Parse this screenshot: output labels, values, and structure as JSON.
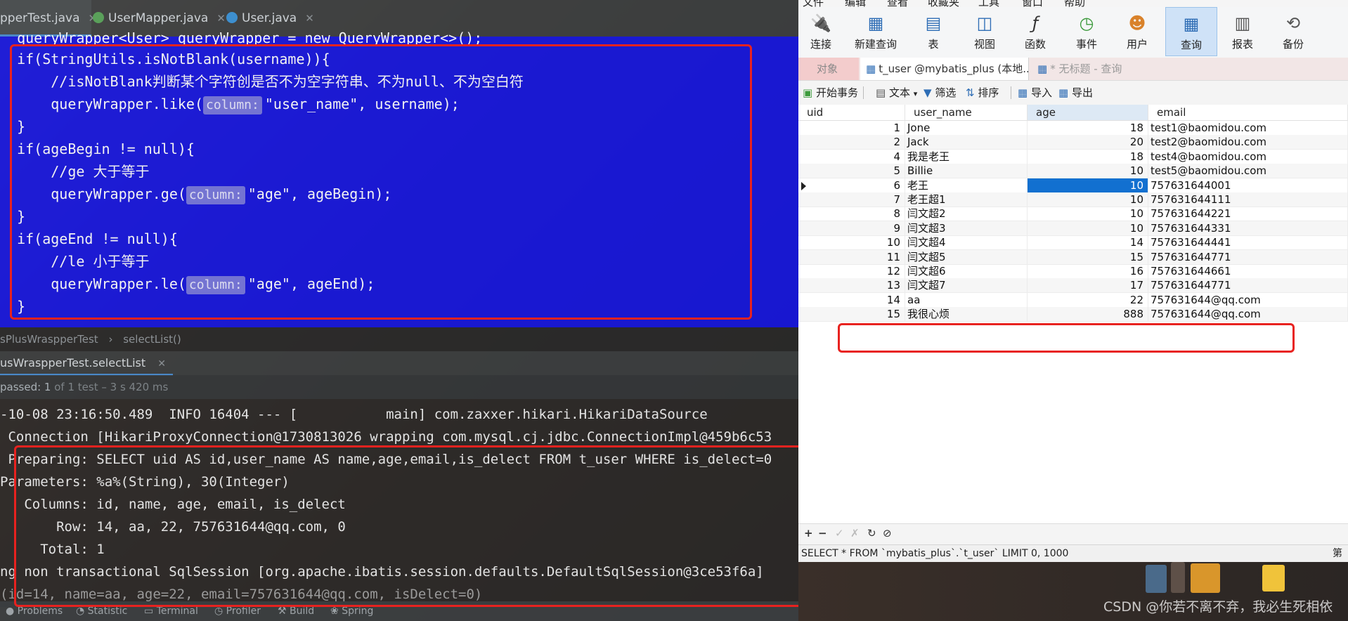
{
  "ide": {
    "tabs": [
      {
        "label": "pperTest.java",
        "icon": "java-class-icon",
        "color": "#5aa05a"
      },
      {
        "label": "UserMapper.java",
        "icon": "java-interface-icon",
        "color": "#5aa05a"
      },
      {
        "label": "User.java",
        "icon": "java-class-icon",
        "color": "#3d8fcf"
      }
    ],
    "code_lines": [
      {
        "indent": "  ",
        "text": "queryWrapper<User> queryWrapper = new QueryWrapper<>();"
      },
      {
        "indent": "  ",
        "text": "if(StringUtils.isNotBlank(username)){"
      },
      {
        "indent": "      ",
        "text": "//isNotBlank判断某个字符创是否不为空字符串、不为null、不为空白符"
      },
      {
        "indent": "      ",
        "pre": "queryWrapper.like(",
        "hint": "column:",
        "post": "\"user_name\", username);"
      },
      {
        "indent": "  ",
        "text": "}"
      },
      {
        "indent": "  ",
        "text": "if(ageBegin != null){"
      },
      {
        "indent": "      ",
        "text": "//ge 大于等于"
      },
      {
        "indent": "      ",
        "pre": "queryWrapper.ge(",
        "hint": "column:",
        "post": "\"age\", ageBegin);"
      },
      {
        "indent": "  ",
        "text": "}"
      },
      {
        "indent": "  ",
        "text": "if(ageEnd != null){"
      },
      {
        "indent": "      ",
        "text": "//le 小于等于"
      },
      {
        "indent": "      ",
        "pre": "queryWrapper.le(",
        "hint": "column:",
        "post": "\"age\", ageEnd);"
      },
      {
        "indent": "  ",
        "text": "}"
      }
    ],
    "breadcrumb": [
      "sPlusWraspperTest",
      "selectList()"
    ],
    "run_tab": "usWraspperTest.selectList",
    "pass_text": "passed: 1",
    "pass_detail": "of 1 test – 3 s 420 ms",
    "console": [
      "-10-08 23:16:50.489  INFO 16404 --- [           main] com.zaxxer.hikari.HikariDataSource",
      " Connection [HikariProxyConnection@1730813026 wrapping com.mysql.cj.jdbc.ConnectionImpl@459b6c53",
      " Preparing: SELECT uid AS id,user_name AS name,age,email,is_delect FROM t_user WHERE is_delect=0",
      "Parameters: %a%(String), 30(Integer)",
      "   Columns: id, name, age, email, is_delect",
      "       Row: 14, aa, 22, 757631644@qq.com, 0",
      "     Total: 1",
      "ng non transactional SqlSession [org.apache.ibatis.session.defaults.DefaultSqlSession@3ce53f6a]",
      "(id=14, name=aa, age=22, email=757631644@qq.com, isDelect=0)"
    ],
    "bottom_tools": [
      "Problems",
      "Statistic",
      "Terminal",
      "Profiler",
      "Build",
      "Spring"
    ]
  },
  "navicat": {
    "menu": [
      "文件",
      "编辑",
      "查看",
      "收藏夹",
      "工具",
      "窗口",
      "帮助"
    ],
    "toolbar": [
      {
        "label": "连接",
        "icon": "plug-icon"
      },
      {
        "label": "新建查询",
        "icon": "new-query-icon"
      },
      {
        "label": "表",
        "icon": "table-icon"
      },
      {
        "label": "视图",
        "icon": "view-icon"
      },
      {
        "label": "函数",
        "icon": "function-icon"
      },
      {
        "label": "事件",
        "icon": "clock-icon"
      },
      {
        "label": "用户",
        "icon": "user-icon"
      },
      {
        "label": "查询",
        "icon": "query-icon"
      },
      {
        "label": "报表",
        "icon": "report-icon"
      },
      {
        "label": "备份",
        "icon": "backup-icon"
      }
    ],
    "object_tab": "对象",
    "table_tab": "t_user @mybatis_plus (本地...",
    "query_tab": "* 无标题 - 查询",
    "subbar": [
      "开始事务",
      "文本",
      "筛选",
      "排序",
      "导入",
      "导出"
    ],
    "columns": [
      "uid",
      "user_name",
      "age",
      "email"
    ],
    "rows": [
      [
        "1",
        "Jone",
        "18",
        "test1@baomidou.com"
      ],
      [
        "2",
        "Jack",
        "20",
        "test2@baomidou.com"
      ],
      [
        "4",
        "我是老王",
        "18",
        "test4@baomidou.com"
      ],
      [
        "5",
        "Billie",
        "10",
        "test5@baomidou.com"
      ],
      [
        "6",
        "老王",
        "10",
        "757631644001"
      ],
      [
        "7",
        "老王超1",
        "10",
        "757631644111"
      ],
      [
        "8",
        "闫文超2",
        "10",
        "757631644221"
      ],
      [
        "9",
        "闫文超3",
        "10",
        "757631644331"
      ],
      [
        "10",
        "闫文超4",
        "14",
        "757631644441"
      ],
      [
        "11",
        "闫文超5",
        "15",
        "757631644771"
      ],
      [
        "12",
        "闫文超6",
        "16",
        "757631644661"
      ],
      [
        "13",
        "闫文超7",
        "17",
        "757631644771"
      ],
      [
        "14",
        "aa",
        "22",
        "757631644@qq.com"
      ],
      [
        "15",
        "我很心烦",
        "888",
        "757631644@qq.com"
      ]
    ],
    "footer_buttons": [
      "+",
      "−",
      "✓",
      "✗",
      "↻",
      "⊘"
    ],
    "status_sql": "SELECT * FROM `mybatis_plus`.`t_user` LIMIT 0, 1000",
    "status_right": "第"
  },
  "watermark": "CSDN @你若不离不弃，我必生死相依",
  "colors": {
    "highlight_rect": "#e8221f",
    "code_bg": "#1414eb",
    "selected_cell": "#1270d0"
  }
}
